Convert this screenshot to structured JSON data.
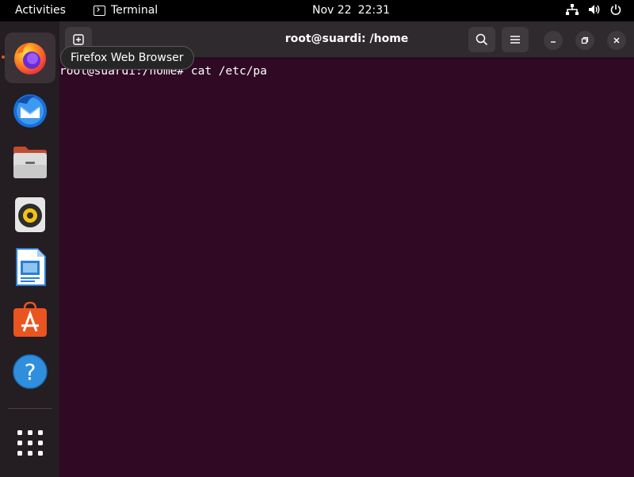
{
  "topbar": {
    "activities": "Activities",
    "app_name": "Terminal",
    "date": "Nov 22",
    "time": "22:31"
  },
  "dock": {
    "items": [
      {
        "name": "Firefox Web Browser",
        "icon": "firefox-icon"
      },
      {
        "name": "Thunderbird Mail",
        "icon": "thunderbird-icon"
      },
      {
        "name": "Files",
        "icon": "files-icon"
      },
      {
        "name": "Rhythmbox",
        "icon": "rhythmbox-icon"
      },
      {
        "name": "LibreOffice Writer",
        "icon": "writer-icon"
      },
      {
        "name": "Ubuntu Software",
        "icon": "software-icon"
      },
      {
        "name": "Help",
        "icon": "help-icon"
      }
    ],
    "show_apps_icon": "app-grid-icon"
  },
  "tooltip": {
    "text": "Firefox Web Browser"
  },
  "window": {
    "title": "root@suardi: /home"
  },
  "terminal": {
    "line1": "root@suardi:/home# cat /etc/pa"
  },
  "colors": {
    "terminal_bg": "#300a24",
    "accent": "#e95420"
  }
}
